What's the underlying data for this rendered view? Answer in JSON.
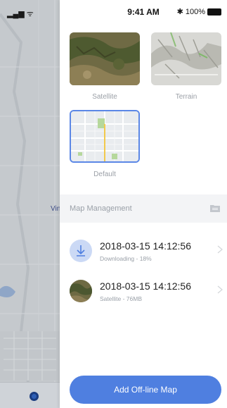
{
  "status_bar": {
    "time": "9:41 AM",
    "battery": "100%"
  },
  "background_map": {
    "label": "Vin"
  },
  "map_types": [
    {
      "label": "Satellite",
      "selected": false
    },
    {
      "label": "Terrain",
      "selected": false
    },
    {
      "label": "Default",
      "selected": true
    }
  ],
  "map_management": {
    "title": "Map Management",
    "items": [
      {
        "title": "2018-03-15 14:12:56",
        "subtitle": "Downloading - 18%",
        "icon": "download-icon"
      },
      {
        "title": "2018-03-15 14:12:56",
        "subtitle": "Satellite - 76MB",
        "icon": "satellite-thumbnail"
      }
    ]
  },
  "add_button": {
    "label": "Add Off-line Map"
  },
  "colors": {
    "accent": "#4f7fe0",
    "selected_border": "#5b87e6",
    "section_bg": "#f3f4f6"
  }
}
